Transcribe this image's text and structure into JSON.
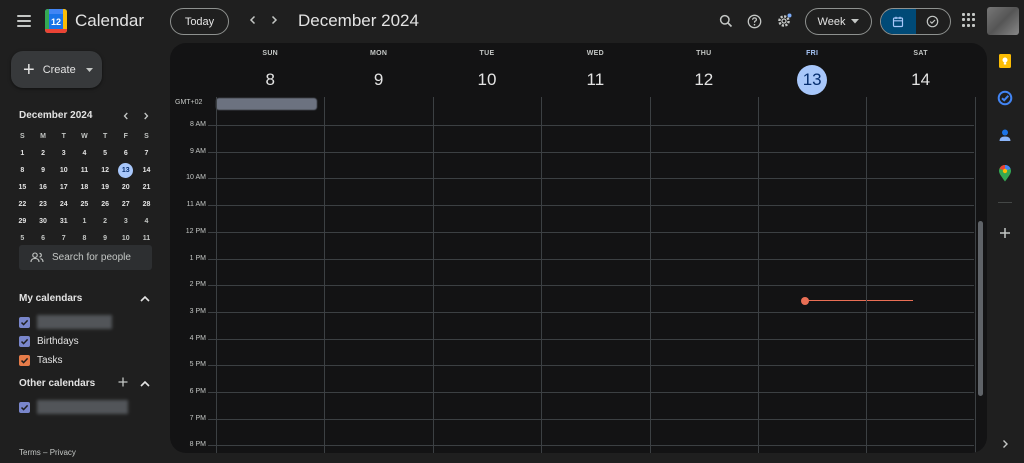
{
  "header": {
    "app_title": "Calendar",
    "logo_number": "12",
    "today_label": "Today",
    "prev_icon": "chevron-left-icon",
    "next_icon": "chevron-right-icon",
    "date_title": "December 2024",
    "view_select": "Week",
    "icons": [
      "search-icon",
      "help-icon",
      "settings-icon",
      "calendar-view-icon",
      "tasks-view-icon",
      "apps-grid-icon"
    ]
  },
  "sidebar": {
    "create_label": "Create",
    "mini_calendar": {
      "title": "December 2024",
      "weekday_headers": [
        "S",
        "M",
        "T",
        "W",
        "T",
        "F",
        "S"
      ],
      "weeks": [
        [
          "1",
          "2",
          "3",
          "4",
          "5",
          "6",
          "7"
        ],
        [
          "8",
          "9",
          "10",
          "11",
          "12",
          "13",
          "14"
        ],
        [
          "15",
          "16",
          "17",
          "18",
          "19",
          "20",
          "21"
        ],
        [
          "22",
          "23",
          "24",
          "25",
          "26",
          "27",
          "28"
        ],
        [
          "29",
          "30",
          "31",
          "1",
          "2",
          "3",
          "4"
        ],
        [
          "5",
          "6",
          "7",
          "8",
          "9",
          "10",
          "11"
        ]
      ],
      "today": "13"
    },
    "search_people_placeholder": "Search for people",
    "my_calendars": {
      "title": "My calendars",
      "items": [
        {
          "label": "",
          "color": "#7986cb",
          "redacted": true
        },
        {
          "label": "Birthdays",
          "color": "#7986cb",
          "redacted": false
        },
        {
          "label": "Tasks",
          "color": "#e67c49",
          "redacted": false
        }
      ]
    },
    "other_calendars": {
      "title": "Other calendars",
      "items": [
        {
          "label": "",
          "color": "#7986cb",
          "redacted": true
        }
      ]
    },
    "footer": {
      "terms": "Terms",
      "separator": "–",
      "privacy": "Privacy"
    }
  },
  "week_view": {
    "timezone": "GMT+02",
    "days": [
      {
        "name": "SUN",
        "number": "8",
        "today": false
      },
      {
        "name": "MON",
        "number": "9",
        "today": false
      },
      {
        "name": "TUE",
        "number": "10",
        "today": false
      },
      {
        "name": "WED",
        "number": "11",
        "today": false
      },
      {
        "name": "THU",
        "number": "12",
        "today": false
      },
      {
        "name": "FRI",
        "number": "13",
        "today": true
      },
      {
        "name": "SAT",
        "number": "14",
        "today": false
      }
    ],
    "hours": [
      "8 AM",
      "9 AM",
      "10 AM",
      "11 AM",
      "12 PM",
      "1 PM",
      "2 PM",
      "3 PM",
      "4 PM",
      "5 PM",
      "6 PM",
      "7 PM",
      "8 PM"
    ],
    "current_time_color": "#ea6f55"
  },
  "side_panel": {
    "icons": [
      "keep-icon",
      "tasks-icon",
      "contacts-icon",
      "maps-icon",
      "add-addon-icon",
      "expand-panel-icon"
    ]
  },
  "colors": {
    "accent": "#a8c7fa",
    "background": "#1f1f1f",
    "panel": "#131314",
    "active_view": "#004a77"
  }
}
